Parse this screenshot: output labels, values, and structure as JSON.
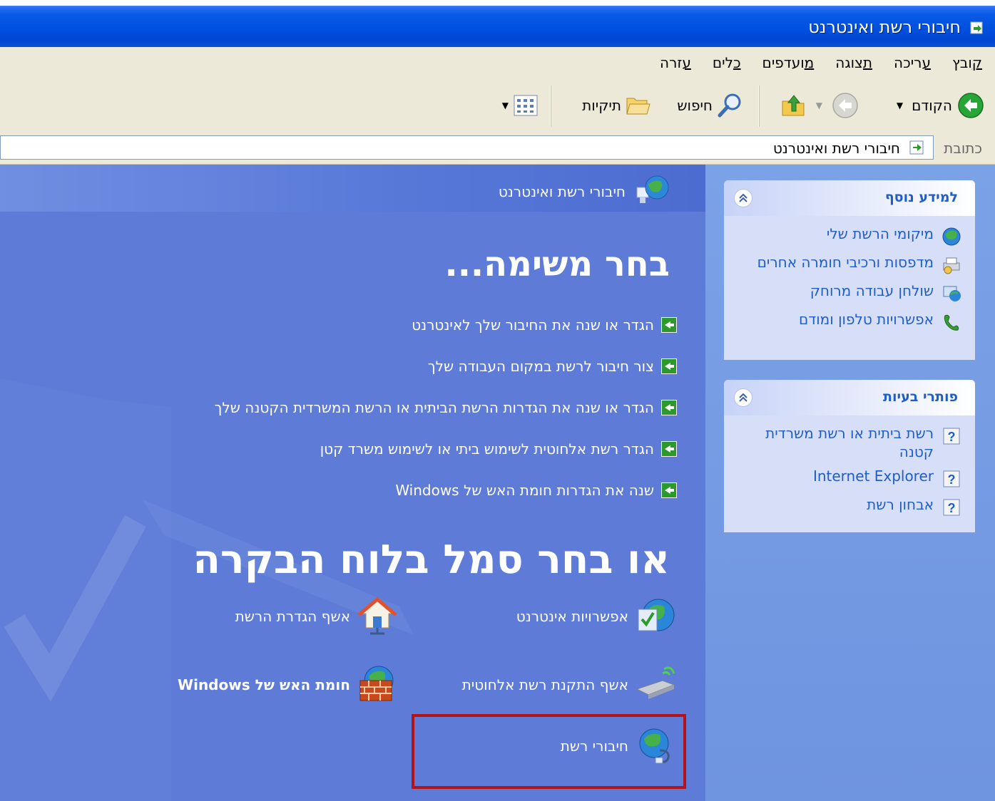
{
  "window": {
    "title": "חיבורי רשת ואינטרנט"
  },
  "menu": {
    "items": [
      {
        "label": "קובץ",
        "accel": "ק"
      },
      {
        "label": "עריכה",
        "accel": "ע"
      },
      {
        "label": "תצוגה",
        "accel": "ת"
      },
      {
        "label": "מועדפים",
        "accel": "מ"
      },
      {
        "label": "כלים",
        "accel": "כ"
      },
      {
        "label": "עזרה",
        "accel": "ע"
      }
    ]
  },
  "toolbar": {
    "back_label": "הקודם",
    "search_label": "חיפוש",
    "folders_label": "תיקיות"
  },
  "address": {
    "label": "כתובת",
    "value": "חיבורי רשת ואינטרנט"
  },
  "sidebar": {
    "see_also": {
      "title": "למידע נוסף",
      "items": [
        {
          "label": "מיקומי הרשת שלי",
          "icon": "network-places-icon"
        },
        {
          "label": "מדפסות ורכיבי חומרה אחרים",
          "icon": "printers-icon"
        },
        {
          "label": "שולחן עבודה מרוחק",
          "icon": "remote-desktop-icon"
        },
        {
          "label": "אפשרויות טלפון ומודם",
          "icon": "phone-modem-icon"
        }
      ]
    },
    "troubleshooters": {
      "title": "פותרי בעיות",
      "items": [
        {
          "label": "רשת ביתית או רשת משרדית קטנה",
          "icon": "help-icon"
        },
        {
          "label": "Internet Explorer",
          "icon": "help-icon"
        },
        {
          "label": "אבחון רשת",
          "icon": "help-icon"
        }
      ]
    }
  },
  "main": {
    "category_title": "חיבורי רשת ואינטרנט",
    "pick_task_title": "בחר משימה...",
    "tasks": [
      "הגדר או שנה את החיבור שלך לאינטרנט",
      "צור חיבור לרשת במקום העבודה שלך",
      "הגדר או שנה את הגדרות הרשת הביתית או הרשת המשרדית הקטנה שלך",
      "הגדר רשת אלחוטית לשימוש ביתי או לשימוש משרד קטן",
      "שנה את הגדרות חומת האש של Windows"
    ],
    "pick_icon_title": "או בחר סמל בלוח הבקרה",
    "icons": [
      {
        "label": "אפשרויות אינטרנט",
        "icon": "internet-options-icon"
      },
      {
        "label": "אשף הגדרת הרשת",
        "icon": "network-setup-wizard-icon"
      },
      {
        "label": "אשף התקנת רשת אלחוטית",
        "icon": "wireless-setup-icon"
      },
      {
        "label": "חומת האש של Windows",
        "icon": "firewall-icon"
      },
      {
        "label": "חיבורי רשת",
        "icon": "network-connections-icon"
      }
    ]
  },
  "colors": {
    "title_bar": "#0050e0",
    "main_bg": "#5d7bd7",
    "sidebar_bg": "#7ba2e7",
    "link": "#215dc6",
    "highlight": "#b3141c"
  }
}
